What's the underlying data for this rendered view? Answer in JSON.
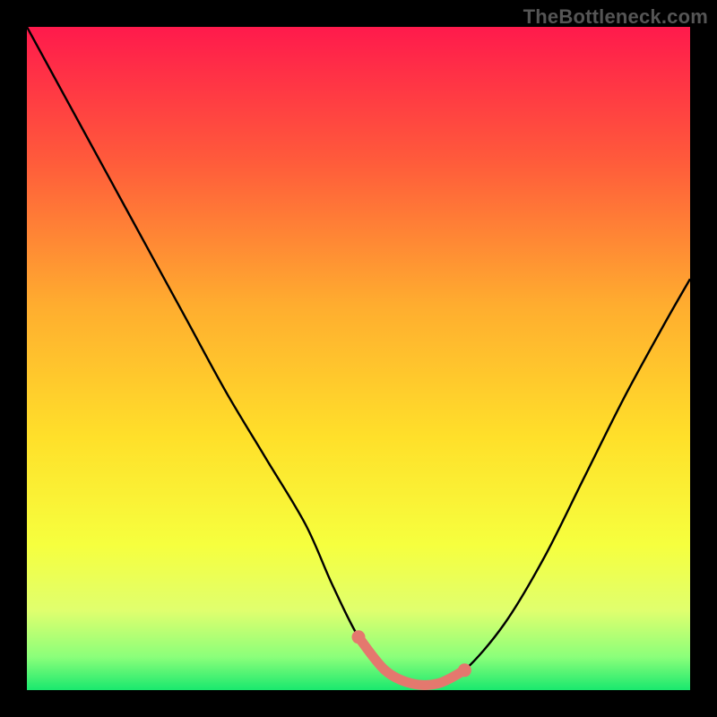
{
  "watermark": "TheBottleneck.com",
  "chart_data": {
    "type": "line",
    "title": "",
    "xlabel": "",
    "ylabel": "",
    "xlim": [
      0,
      100
    ],
    "ylim": [
      0,
      100
    ],
    "gradient_stops": [
      {
        "offset": 0,
        "color": "#ff1a4c"
      },
      {
        "offset": 20,
        "color": "#ff5a3b"
      },
      {
        "offset": 42,
        "color": "#ffad2f"
      },
      {
        "offset": 62,
        "color": "#ffe02a"
      },
      {
        "offset": 78,
        "color": "#f6ff3e"
      },
      {
        "offset": 88,
        "color": "#e0ff6e"
      },
      {
        "offset": 95,
        "color": "#8bff7a"
      },
      {
        "offset": 100,
        "color": "#19e86e"
      }
    ],
    "series": [
      {
        "name": "bottleneck-curve",
        "x": [
          0,
          6,
          12,
          18,
          24,
          30,
          36,
          42,
          46,
          50,
          54,
          58,
          62,
          66,
          72,
          78,
          84,
          90,
          96,
          100
        ],
        "y": [
          100,
          89,
          78,
          67,
          56,
          45,
          35,
          25,
          16,
          8,
          3,
          1,
          1,
          3,
          10,
          20,
          32,
          44,
          55,
          62
        ]
      }
    ],
    "highlight_segment": {
      "name": "bottleneck-optimal-range",
      "x_start": 50,
      "x_end": 66,
      "color": "#e4786e"
    }
  }
}
